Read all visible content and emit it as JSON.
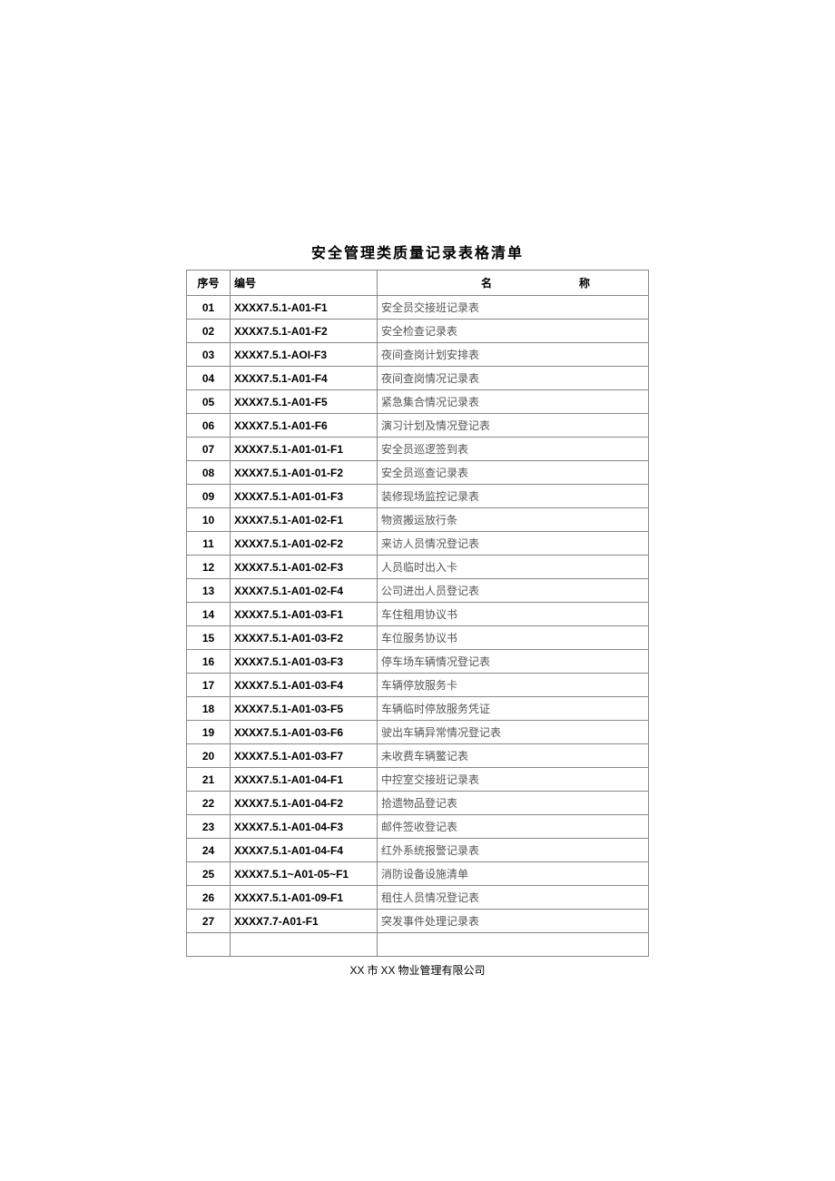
{
  "title": "安全管理类质量记录表格清单",
  "headers": {
    "seq": "序号",
    "code": "编号",
    "name_left": "名",
    "name_right": "称"
  },
  "rows": [
    {
      "seq": "01",
      "code": "XXXX7.5.1-A01-F1",
      "name": "安全员交接班记录表"
    },
    {
      "seq": "02",
      "code": "XXXX7.5.1-A01-F2",
      "name": "安全检查记录表"
    },
    {
      "seq": "03",
      "code": "XXXX7.5.1-AOI-F3",
      "name": "夜间查岗计划安排表"
    },
    {
      "seq": "04",
      "code": "XXXX7.5.1-A01-F4",
      "name": "夜间查岗情况记录表"
    },
    {
      "seq": "05",
      "code": "XXXX7.5.1-A01-F5",
      "name": "紧急集合情况记录表"
    },
    {
      "seq": "06",
      "code": "XXXX7.5.1-A01-F6",
      "name": "演习计划及情况登记表"
    },
    {
      "seq": "07",
      "code": "XXXX7.5.1-A01-01-F1",
      "name": "安全员巡逻签到表"
    },
    {
      "seq": "08",
      "code": "XXXX7.5.1-A01-01-F2",
      "name": "安全员巡查记录表"
    },
    {
      "seq": "09",
      "code": "XXXX7.5.1-A01-01-F3",
      "name": "装修现场监控记录表"
    },
    {
      "seq": "10",
      "code": "XXXX7.5.1-A01-02-F1",
      "name": "物资搬运放行条"
    },
    {
      "seq": "11",
      "code": "XXXX7.5.1-A01-02-F2",
      "name": "来访人员情况登记表"
    },
    {
      "seq": "12",
      "code": "XXXX7.5.1-A01-02-F3",
      "name": "人员临时出入卡"
    },
    {
      "seq": "13",
      "code": "XXXX7.5.1-A01-02-F4",
      "name": "公司进出人员登记表"
    },
    {
      "seq": "14",
      "code": "XXXX7.5.1-A01-03-F1",
      "name": "车住租用协议书"
    },
    {
      "seq": "15",
      "code": "XXXX7.5.1-A01-03-F2",
      "name": "车位服务协议书"
    },
    {
      "seq": "16",
      "code": "XXXX7.5.1-A01-03-F3",
      "name": "停车场车辆情况登记表"
    },
    {
      "seq": "17",
      "code": "XXXX7.5.1-A01-03-F4",
      "name": "车辆停放服务卡"
    },
    {
      "seq": "18",
      "code": "XXXX7.5.1-A01-03-F5",
      "name": "车辆临时停放服务凭证"
    },
    {
      "seq": "19",
      "code": "XXXX7.5.1-A01-03-F6",
      "name": "驶出车辆异常情况登记表"
    },
    {
      "seq": "20",
      "code": "XXXX7.5.1-A01-03-F7",
      "name": "未收费车辆鳖记表"
    },
    {
      "seq": "21",
      "code": "XXXX7.5.1-A01-04-F1",
      "name": "中控室交接班记录表"
    },
    {
      "seq": "22",
      "code": "XXXX7.5.1-A01-04-F2",
      "name": "拾遗物品登记表"
    },
    {
      "seq": "23",
      "code": "XXXX7.5.1-A01-04-F3",
      "name": "邮件签收登记表"
    },
    {
      "seq": "24",
      "code": "XXXX7.5.1-A01-04-F4",
      "name": "红外系统报警记录表"
    },
    {
      "seq": "25",
      "code": "XXXX7.5.1~A01-05~F1",
      "name": "消防设备设施清单"
    },
    {
      "seq": "26",
      "code": "XXXX7.5.1-A01-09-F1",
      "name": "租住人员情况登记表"
    },
    {
      "seq": "27",
      "code": "XXXX7.7-A01-F1",
      "name": "突发事件处理记录表"
    }
  ],
  "footer": {
    "xx1": "XX",
    "mid1": " 市 ",
    "xx2": "XX",
    "mid2": " 物业管理有限公司"
  }
}
